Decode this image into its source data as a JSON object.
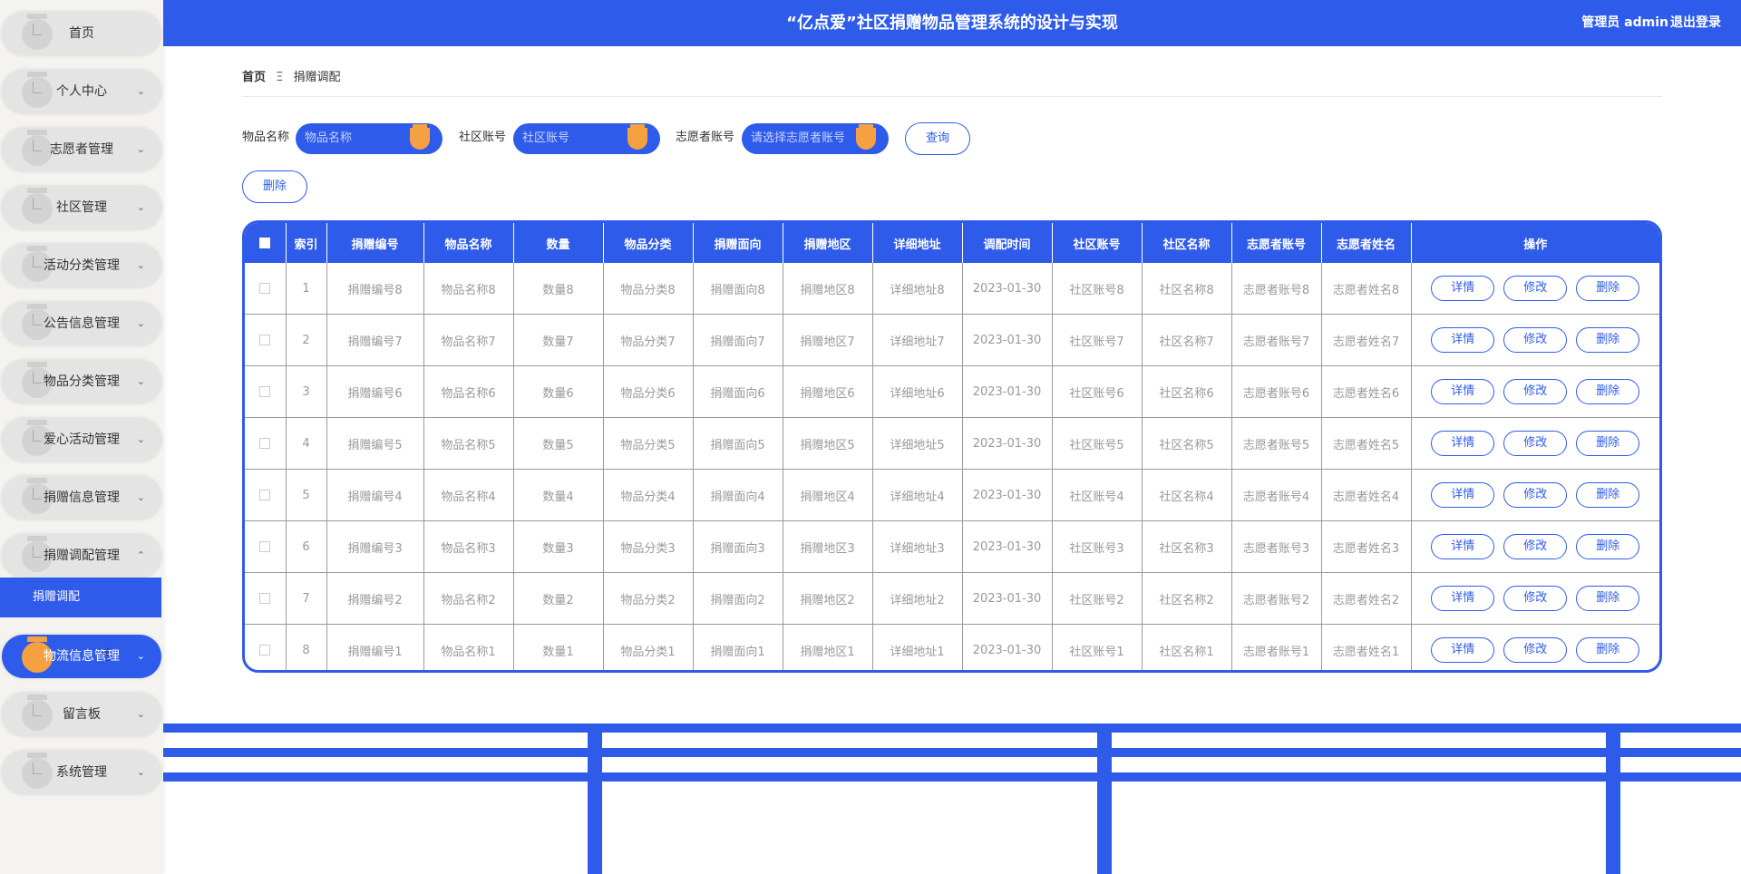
{
  "header": {
    "title": "“亿点爱”社区捐赠物品管理系统的设计与实现",
    "user": "管理员 admin",
    "logout": "退出登录"
  },
  "sidebar": {
    "items": [
      {
        "label": "首页",
        "chevron": ""
      },
      {
        "label": "个人中心",
        "chevron": "⌄"
      },
      {
        "label": "志愿者管理",
        "chevron": "⌄"
      },
      {
        "label": "社区管理",
        "chevron": "⌄"
      },
      {
        "label": "活动分类管理",
        "chevron": "⌄"
      },
      {
        "label": "公告信息管理",
        "chevron": "⌄"
      },
      {
        "label": "物品分类管理",
        "chevron": "⌄"
      },
      {
        "label": "爱心活动管理",
        "chevron": "⌄"
      },
      {
        "label": "捐赠信息管理",
        "chevron": "⌄"
      },
      {
        "label": "捐赠调配管理",
        "chevron": "⌃"
      },
      {
        "label": "物流信息管理",
        "chevron": "⌄"
      },
      {
        "label": "留言板",
        "chevron": "⌄"
      },
      {
        "label": "系统管理",
        "chevron": "⌄"
      }
    ],
    "sub_item": "捐赠调配",
    "active_index": 10
  },
  "breadcrumb": {
    "home": "首页",
    "separator": "Ξ",
    "current": "捐赠调配"
  },
  "search": {
    "item_name_label": "物品名称",
    "item_name_placeholder": "物品名称",
    "community_label": "社区账号",
    "community_placeholder": "社区账号",
    "volunteer_label": "志愿者账号",
    "volunteer_placeholder": "请选择志愿者账号",
    "query_button": "查询",
    "delete_button": "删除"
  },
  "table": {
    "columns": [
      "索引",
      "捐赠编号",
      "物品名称",
      "数量",
      "物品分类",
      "捐赠面向",
      "捐赠地区",
      "详细地址",
      "调配时间",
      "社区账号",
      "社区名称",
      "志愿者账号",
      "志愿者姓名",
      "操作"
    ],
    "rows": [
      [
        "1",
        "捐赠编号8",
        "物品名称8",
        "数量8",
        "物品分类8",
        "捐赠面向8",
        "捐赠地区8",
        "详细地址8",
        "2023-01-30",
        "社区账号8",
        "社区名称8",
        "志愿者账号8",
        "志愿者姓名8"
      ],
      [
        "2",
        "捐赠编号7",
        "物品名称7",
        "数量7",
        "物品分类7",
        "捐赠面向7",
        "捐赠地区7",
        "详细地址7",
        "2023-01-30",
        "社区账号7",
        "社区名称7",
        "志愿者账号7",
        "志愿者姓名7"
      ],
      [
        "3",
        "捐赠编号6",
        "物品名称6",
        "数量6",
        "物品分类6",
        "捐赠面向6",
        "捐赠地区6",
        "详细地址6",
        "2023-01-30",
        "社区账号6",
        "社区名称6",
        "志愿者账号6",
        "志愿者姓名6"
      ],
      [
        "4",
        "捐赠编号5",
        "物品名称5",
        "数量5",
        "物品分类5",
        "捐赠面向5",
        "捐赠地区5",
        "详细地址5",
        "2023-01-30",
        "社区账号5",
        "社区名称5",
        "志愿者账号5",
        "志愿者姓名5"
      ],
      [
        "5",
        "捐赠编号4",
        "物品名称4",
        "数量4",
        "物品分类4",
        "捐赠面向4",
        "捐赠地区4",
        "详细地址4",
        "2023-01-30",
        "社区账号4",
        "社区名称4",
        "志愿者账号4",
        "志愿者姓名4"
      ],
      [
        "6",
        "捐赠编号3",
        "物品名称3",
        "数量3",
        "物品分类3",
        "捐赠面向3",
        "捐赠地区3",
        "详细地址3",
        "2023-01-30",
        "社区账号3",
        "社区名称3",
        "志愿者账号3",
        "志愿者姓名3"
      ],
      [
        "7",
        "捐赠编号2",
        "物品名称2",
        "数量2",
        "物品分类2",
        "捐赠面向2",
        "捐赠地区2",
        "详细地址2",
        "2023-01-30",
        "社区账号2",
        "社区名称2",
        "志愿者账号2",
        "志愿者姓名2"
      ],
      [
        "8",
        "捐赠编号1",
        "物品名称1",
        "数量1",
        "物品分类1",
        "捐赠面向1",
        "捐赠地区1",
        "详细地址1",
        "2023-01-30",
        "社区账号1",
        "社区名称1",
        "志愿者账号1",
        "志愿者姓名1"
      ]
    ],
    "actions": [
      "详情",
      "修改",
      "删除"
    ]
  },
  "colors": {
    "primary": "#2f5bea",
    "accent": "#f5a142",
    "sidebar_bg": "#f4f3ef",
    "menu_item_bg": "#e4e4e4"
  }
}
